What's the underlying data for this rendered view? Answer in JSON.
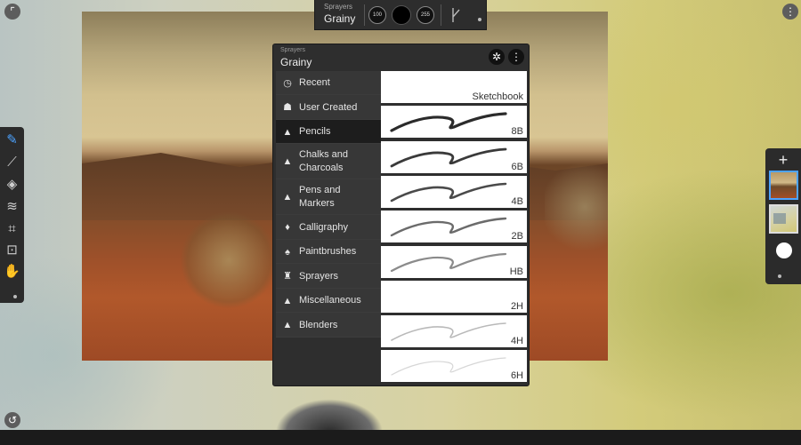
{
  "top_toolbar": {
    "category": "Sprayers",
    "brush_name": "Grainy",
    "size_value": "100",
    "opacity_value": "255"
  },
  "panel": {
    "category": "Sprayers",
    "brush_name": "Grainy",
    "categories": [
      {
        "label": "Recent",
        "icon": "clock-icon",
        "active": false
      },
      {
        "label": "User Created",
        "icon": "user-icon",
        "active": false
      },
      {
        "label": "Pencils",
        "icon": "pencil-icon",
        "active": true
      },
      {
        "label": "Chalks and\nCharcoals",
        "icon": "chalk-icon",
        "active": false
      },
      {
        "label": "Pens and\nMarkers",
        "icon": "pen-icon",
        "active": false
      },
      {
        "label": "Calligraphy",
        "icon": "nib-icon",
        "active": false
      },
      {
        "label": "Paintbrushes",
        "icon": "paintbrush-icon",
        "active": false
      },
      {
        "label": "Sprayers",
        "icon": "sprayer-icon",
        "active": false
      },
      {
        "label": "Miscellaneous",
        "icon": "misc-icon",
        "active": false
      },
      {
        "label": "Blenders",
        "icon": "blender-icon",
        "active": false
      }
    ],
    "presets": [
      {
        "label": "Sketchbook",
        "shade": null
      },
      {
        "label": "8B",
        "shade": "#2b2b2b"
      },
      {
        "label": "6B",
        "shade": "#3a3a3a"
      },
      {
        "label": "4B",
        "shade": "#4a4a4a"
      },
      {
        "label": "2B",
        "shade": "#6b6b6b"
      },
      {
        "label": "HB",
        "shade": "#8b8b8b"
      },
      {
        "label": "2H",
        "shade": null
      },
      {
        "label": "4H",
        "shade": "#b9b9b9"
      },
      {
        "label": "6H",
        "shade": "#d6d6d6"
      }
    ]
  },
  "colors": {
    "accent": "#4da3ff",
    "panel_bg": "#2e2e2e",
    "selected_item": "#1d1d1d"
  }
}
